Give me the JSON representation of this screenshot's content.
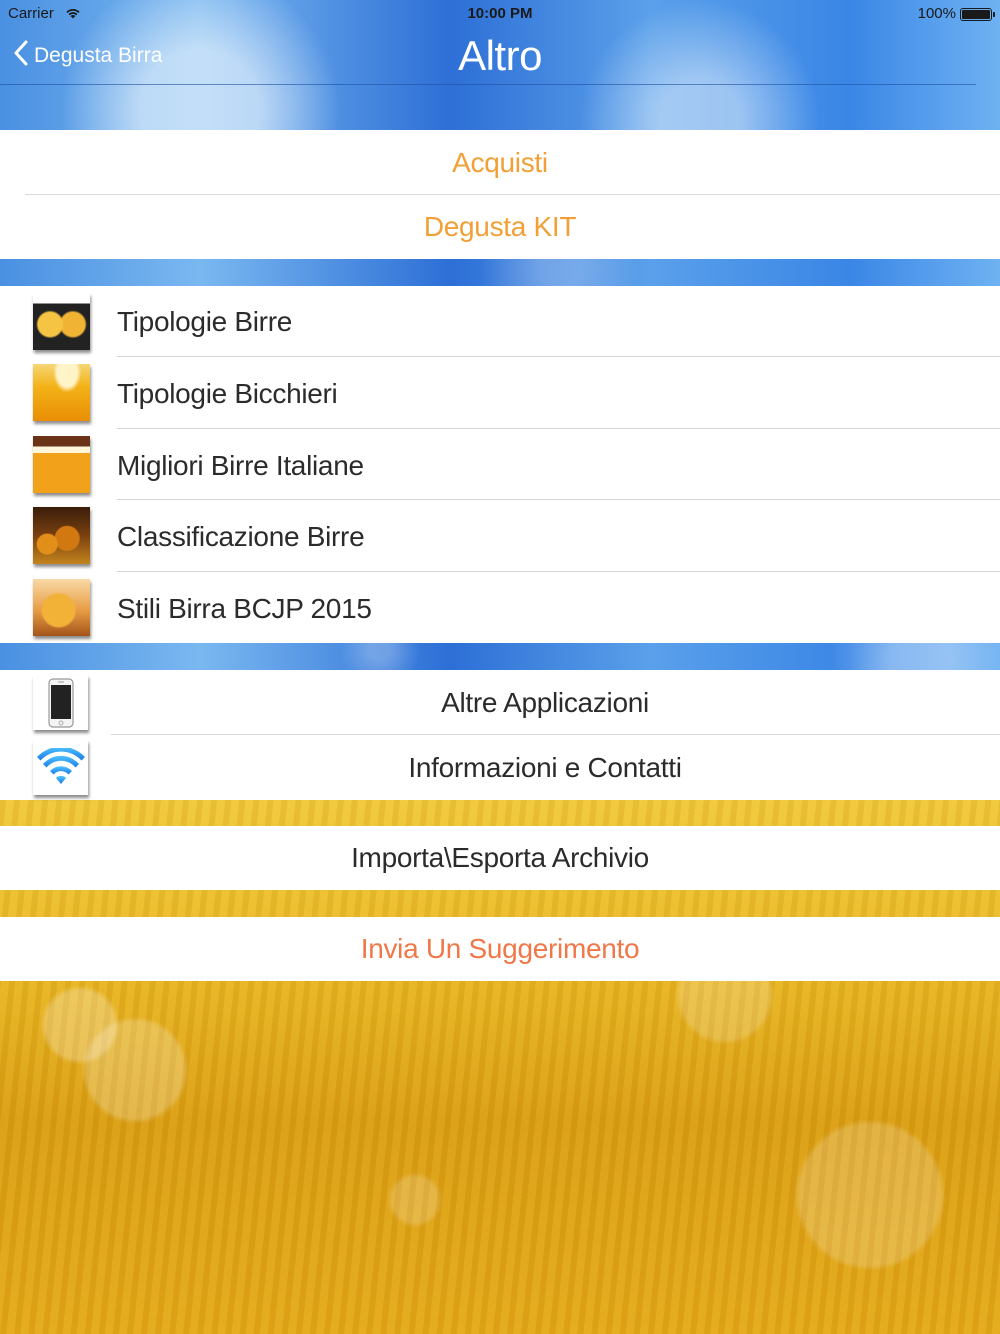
{
  "status_bar": {
    "carrier": "Carrier",
    "time": "10:00 PM",
    "battery": "100%"
  },
  "nav": {
    "back_label": "Degusta Birra",
    "title": "Altro"
  },
  "group1": {
    "items": [
      "Acquisti",
      "Degusta KIT"
    ]
  },
  "group2": {
    "items": [
      {
        "label": "Tipologie Birre",
        "icon": "beer-glasses-icon"
      },
      {
        "label": "Tipologie Bicchieri",
        "icon": "beer-glass-icon"
      },
      {
        "label": "Migliori Birre Italiane",
        "icon": "beer-mug-icon"
      },
      {
        "label": "Classificazione Birre",
        "icon": "beer-bottles-icon"
      },
      {
        "label": "Stili Birra BCJP 2015",
        "icon": "beer-stein-icon"
      }
    ]
  },
  "group3": {
    "items": [
      {
        "label": "Altre Applicazioni",
        "icon": "iphone-icon"
      },
      {
        "label": "Informazioni e Contatti",
        "icon": "wifi-icon"
      }
    ]
  },
  "group4": {
    "label": "Importa\\Esporta Archivio"
  },
  "group5": {
    "label": "Invia Un Suggerimento"
  },
  "colors": {
    "orange": "#f2a036",
    "coral": "#f07848",
    "sky_blue": "#3a86e6",
    "wheat": "#e9b824"
  }
}
